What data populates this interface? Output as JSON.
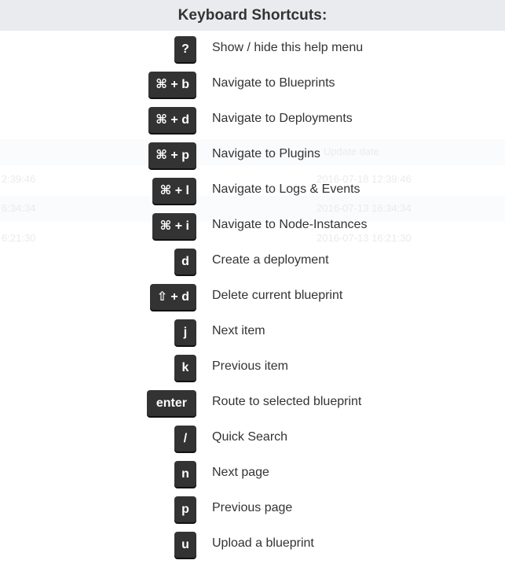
{
  "header": {
    "title": "Keyboard Shortcuts:"
  },
  "background_table": {
    "header_label": "Update date",
    "rows": [
      {
        "left": "2:39:46",
        "right": "2016-07-18 12:39:46"
      },
      {
        "left": "6:34:34",
        "right": "2016-07-13 16:34:34"
      },
      {
        "left": "6:21:30",
        "right": "2016-07-13 16:21:30"
      }
    ]
  },
  "shortcuts": [
    {
      "key": "?",
      "description": "Show / hide this help menu"
    },
    {
      "key": "⌘ + b",
      "description": "Navigate to Blueprints"
    },
    {
      "key": "⌘ + d",
      "description": "Navigate to Deployments"
    },
    {
      "key": "⌘ + p",
      "description": "Navigate to Plugins"
    },
    {
      "key": "⌘ + l",
      "description": "Navigate to Logs & Events"
    },
    {
      "key": "⌘ + i",
      "description": "Navigate to Node-Instances"
    },
    {
      "key": "d",
      "description": "Create a deployment"
    },
    {
      "key": "⇧ + d",
      "description": "Delete current blueprint"
    },
    {
      "key": "j",
      "description": "Next item"
    },
    {
      "key": "k",
      "description": "Previous item"
    },
    {
      "key": "enter",
      "description": "Route to selected blueprint"
    },
    {
      "key": "/",
      "description": "Quick Search"
    },
    {
      "key": "n",
      "description": "Next page"
    },
    {
      "key": "p",
      "description": "Previous page"
    },
    {
      "key": "u",
      "description": "Upload a blueprint"
    }
  ]
}
